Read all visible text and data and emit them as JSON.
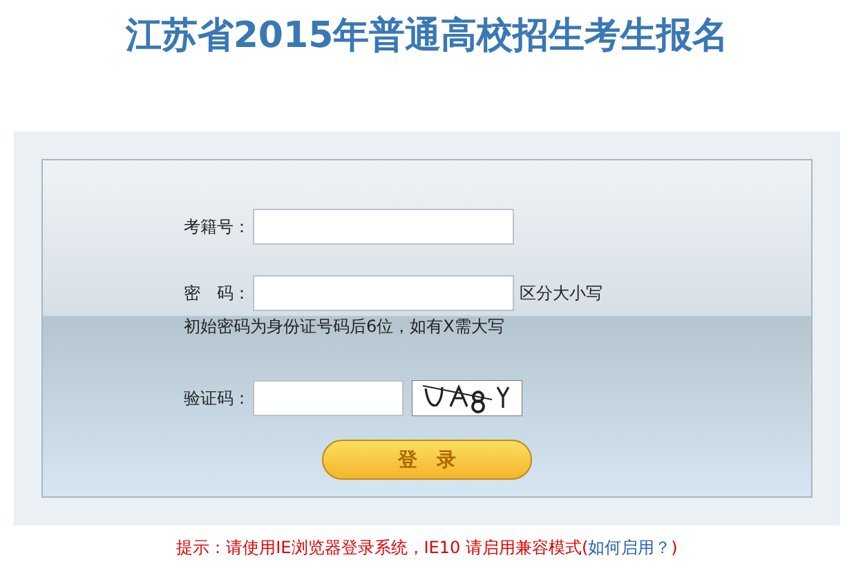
{
  "title": "江苏省2015年普通高校招生考生报名",
  "fields": [
    {
      "label": "考籍号："
    },
    {
      "label": "密　码：",
      "note": "区分大小写"
    }
  ],
  "password_hint": "初始密码为身份证号码后6位，如有X需大写",
  "captcha": {
    "label": "验证码："
  },
  "login_button": "登　录",
  "tip": {
    "text": "提示：请使用IE浏览器登录系统，IE10 请启用兼容模式(",
    "link": "如何启用？",
    "close": ")"
  }
}
